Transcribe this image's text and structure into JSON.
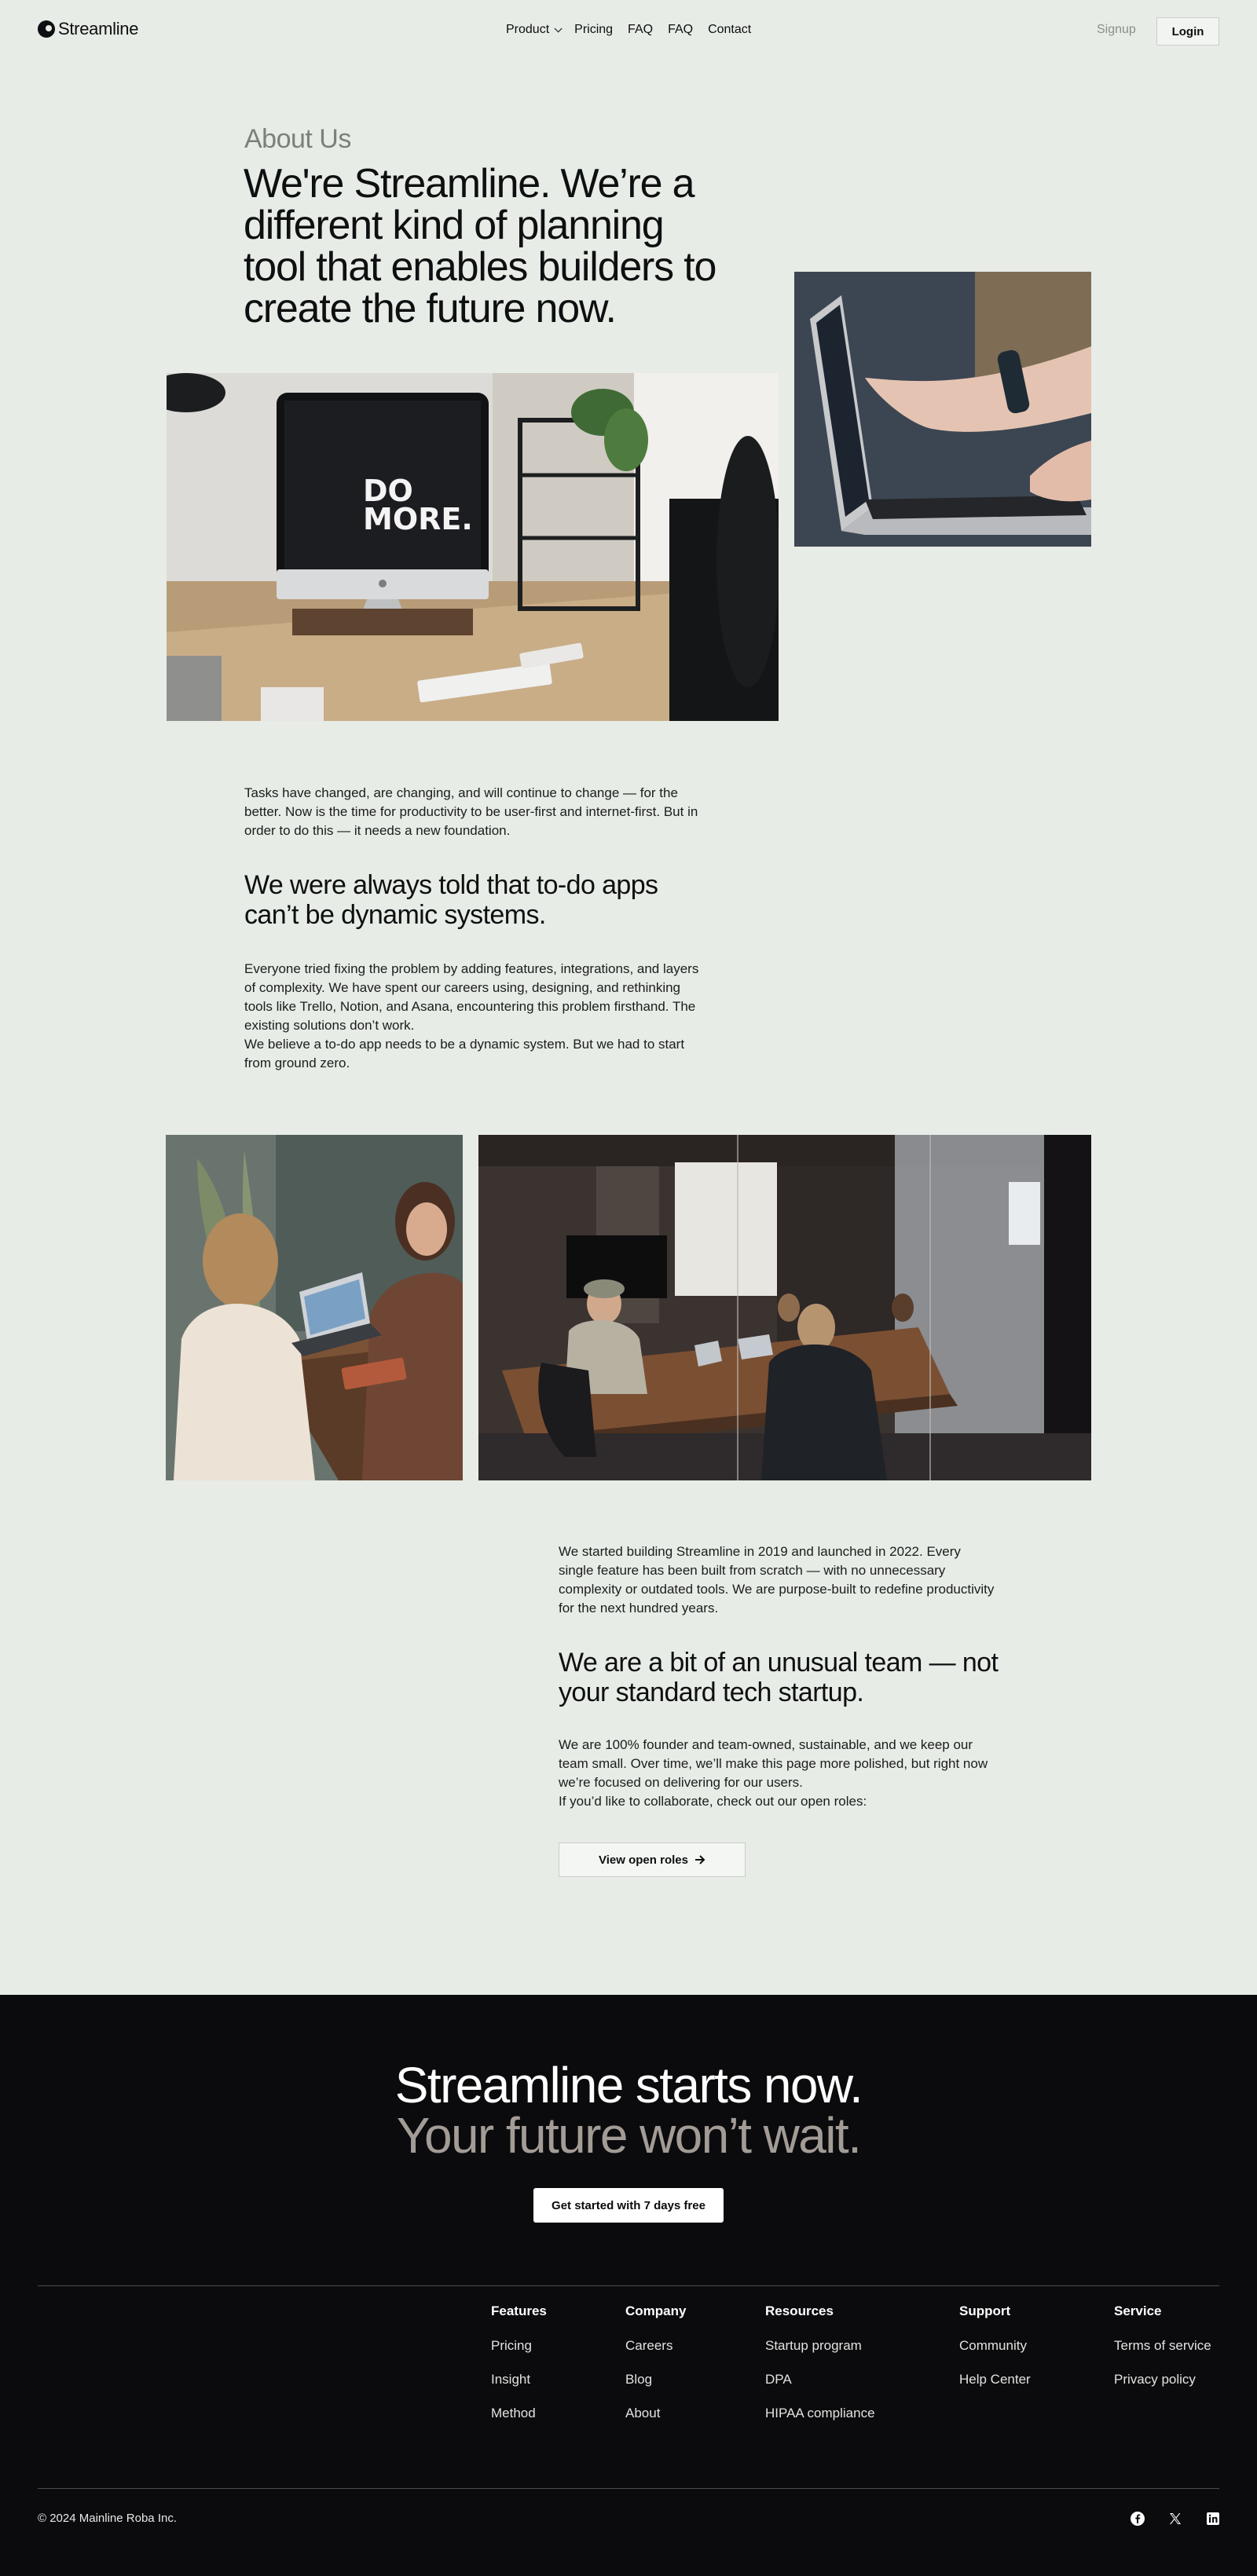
{
  "header": {
    "brand": "Streamline",
    "nav": [
      {
        "label": "Product",
        "dropdown": true
      },
      {
        "label": "Pricing"
      },
      {
        "label": "FAQ"
      },
      {
        "label": "FAQ"
      },
      {
        "label": "Contact"
      }
    ],
    "signup": "Signup",
    "login": "Login"
  },
  "hero": {
    "eyebrow": "About Us",
    "title": "We're Streamline. We’re a different kind of planning tool that enables builders to create the future now."
  },
  "section1": {
    "intro": "Tasks have changed, are changing, and will continue to change — for the better. Now is the time for productivity to be user-first and internet-first. But in order to do this — it needs a new foundation.",
    "heading": "We were always told that to-do apps can’t be dynamic systems.",
    "body_1": "Everyone tried fixing the problem by adding features, integrations, and layers of complexity. We have spent our careers using, designing, and rethinking tools like Trello, Notion, and Asana, encountering this problem firsthand. The existing solutions don’t work.",
    "body_2": "We believe a to-do app needs to be a dynamic system. But we had to start from ground zero."
  },
  "section2": {
    "intro": "We started building Streamline in 2019 and launched in 2022. Every single feature has been built from scratch — with no unnecessary complexity or outdated tools. We are purpose-built to redefine productivity for the next hundred years.",
    "heading": "We are a bit of an unusual team — not your standard tech startup.",
    "body_1": "We are 100% founder and team-owned, sustainable, and we keep our team small. Over time, we’ll make this page more polished, but right now we’re focused on delivering for our users.",
    "body_2": "If you’d like to collaborate, check out our open roles:",
    "button": "View open roles"
  },
  "images": {
    "desk_screen_text": "DO MORE."
  },
  "footer": {
    "cta_line1": "Streamline starts now.",
    "cta_line2": "Your future won’t wait.",
    "cta_button": "Get started with 7 days free",
    "columns": [
      {
        "heading": "Features",
        "items": [
          "Pricing",
          "Insight",
          "Method"
        ]
      },
      {
        "heading": "Company",
        "items": [
          "Careers",
          "Blog",
          "About"
        ]
      },
      {
        "heading": "Resources",
        "items": [
          "Startup program",
          "DPA",
          "HIPAA compliance"
        ]
      },
      {
        "heading": "Support",
        "items": [
          "Community",
          "Help Center"
        ]
      },
      {
        "heading": "Service",
        "items": [
          "Terms of service",
          "Privacy policy"
        ]
      }
    ],
    "copyright": "© 2024 Mainline Roba Inc.",
    "social_icons": [
      "facebook-icon",
      "x-icon",
      "linkedin-icon"
    ]
  },
  "colors": {
    "page_bg": "#e7ece6",
    "footer_bg": "#0b0b0d",
    "muted_text": "#7c807c",
    "cta_muted": "#a39c96"
  }
}
